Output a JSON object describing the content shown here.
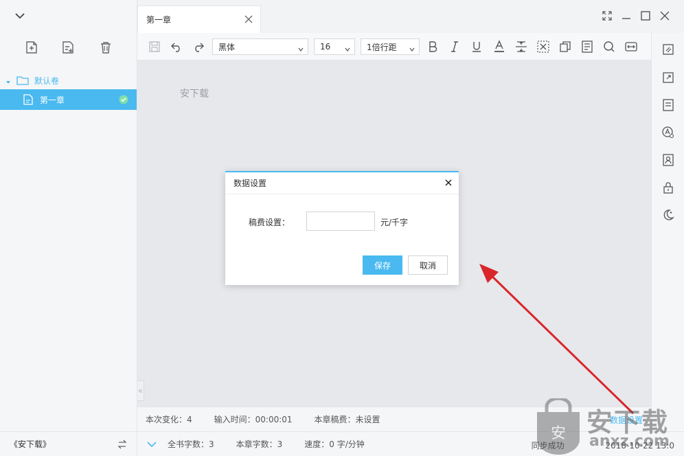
{
  "sidebar": {
    "volume_label": "默认卷",
    "chapter_label": "第一章",
    "footer_book": "《安下载》"
  },
  "tab": {
    "title": "第一章"
  },
  "toolbar": {
    "font_family": "黑体",
    "font_size": "16",
    "line_spacing": "1倍行距"
  },
  "editor": {
    "content": "安下载"
  },
  "dialog": {
    "title": "数据设置",
    "fee_label": "稿费设置：",
    "fee_value": "",
    "fee_unit": "元/千字",
    "save_label": "保存",
    "cancel_label": "取消"
  },
  "status": {
    "change": "本次变化：4",
    "input_time": "输入时间：00:00:01",
    "chapter_fee": "本章稿费：未设置",
    "data_settings": "数据设置",
    "book_words": "全书字数：3",
    "chapter_words": "本章字数：3",
    "speed": "速度：0 字/分钟",
    "sync": "同步成功",
    "timestamp": "2018-10-22 13:0"
  },
  "watermark": {
    "text": "安下载",
    "domain": "anxz.com"
  },
  "colors": {
    "accent": "#49b9f0",
    "arrow": "#d9262b"
  }
}
